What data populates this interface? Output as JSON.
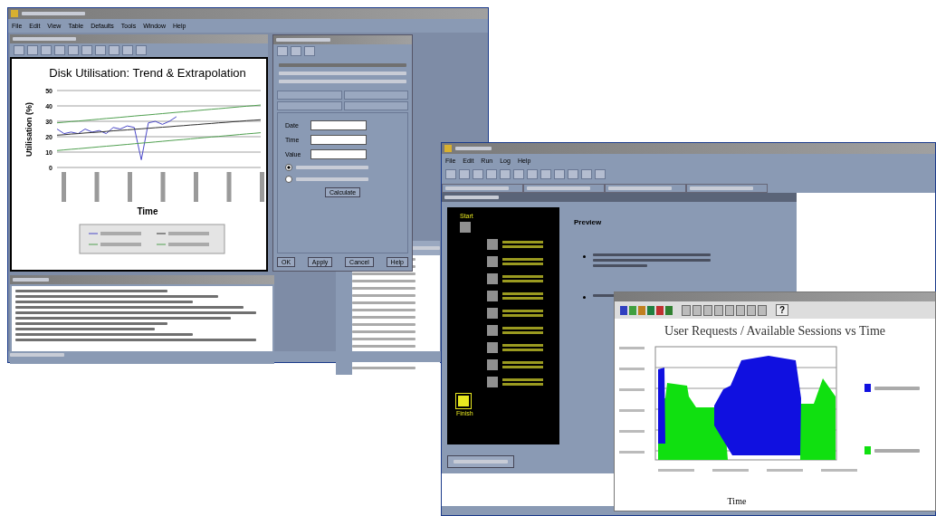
{
  "trend_window": {
    "menu": [
      "File",
      "Edit",
      "View",
      "Table",
      "Defaults",
      "Tools",
      "Window",
      "Help"
    ],
    "chart_window": {
      "chart_data": {
        "type": "line",
        "title": "Disk Utilisation: Trend & Extrapolation",
        "xlabel": "Time",
        "ylabel": "Utilisation (%)",
        "ylim": [
          0,
          50
        ],
        "yticks": [
          0,
          10,
          20,
          30,
          40,
          50
        ],
        "grid": true,
        "series": [
          {
            "color": "#4a48c8",
            "values": [
              25,
              22,
              23,
              22,
              25,
              23,
              24,
              22,
              26,
              25,
              27,
              26,
              5,
              29,
              30,
              28,
              30,
              33,
              null,
              null,
              null,
              null,
              null,
              null,
              null,
              null,
              null,
              null,
              null,
              null
            ]
          },
          {
            "color": "#303030",
            "values": [
              21,
              21.3,
              21.7,
              22,
              22.4,
              22.7,
              23,
              23.4,
              23.8,
              24.1,
              24.4,
              24.8,
              25.1,
              25.5,
              25.8,
              26.2,
              26.5,
              26.9,
              27.2,
              27.6,
              27.9,
              28.3,
              28.6,
              29,
              29.3,
              29.7,
              30,
              30.4,
              30.7,
              31
            ]
          },
          {
            "color": "#50a050",
            "values": [
              29,
              29.4,
              29.8,
              30.2,
              30.6,
              31,
              31.4,
              31.8,
              32.2,
              32.6,
              33,
              33.4,
              33.8,
              34.2,
              34.6,
              35,
              35.4,
              35.8,
              36.2,
              36.6,
              37,
              37.4,
              37.8,
              38.2,
              38.6,
              39,
              39.4,
              39.8,
              40.2,
              40.6
            ]
          },
          {
            "color": "#50a050",
            "values": [
              11,
              11.4,
              11.8,
              12.2,
              12.6,
              13,
              13.4,
              13.8,
              14.2,
              14.6,
              15,
              15.4,
              15.8,
              16.2,
              16.6,
              17,
              17.4,
              17.8,
              18.2,
              18.6,
              19,
              19.4,
              19.8,
              20.2,
              20.6,
              21,
              21.4,
              21.8,
              22.2,
              22.6
            ]
          }
        ]
      }
    },
    "dialog": {
      "fields": [
        {
          "label": "Date"
        },
        {
          "label": "Time"
        },
        {
          "label": "Value"
        }
      ],
      "radios": [
        {
          "selected": true
        },
        {
          "selected": false
        }
      ],
      "calculate_button": "Calculate",
      "buttons": [
        "OK",
        "Apply",
        "Cancel",
        "Help"
      ]
    }
  },
  "run_window": {
    "menu": [
      "File",
      "Edit",
      "Run",
      "Log",
      "Help"
    ],
    "wizard": {
      "steps": [
        {
          "label": "Start",
          "kind": "start"
        },
        {
          "kind": "step"
        },
        {
          "kind": "step"
        },
        {
          "kind": "step"
        },
        {
          "kind": "step"
        },
        {
          "kind": "step"
        },
        {
          "kind": "step"
        },
        {
          "kind": "step"
        },
        {
          "kind": "step"
        },
        {
          "kind": "step"
        },
        {
          "label": "Finish",
          "kind": "finish"
        }
      ],
      "heading": "Preview"
    },
    "chart_window": {
      "title": "User Requests  / Available Sessions vs Time",
      "xlabel": "Time",
      "help_button": "?"
    }
  }
}
